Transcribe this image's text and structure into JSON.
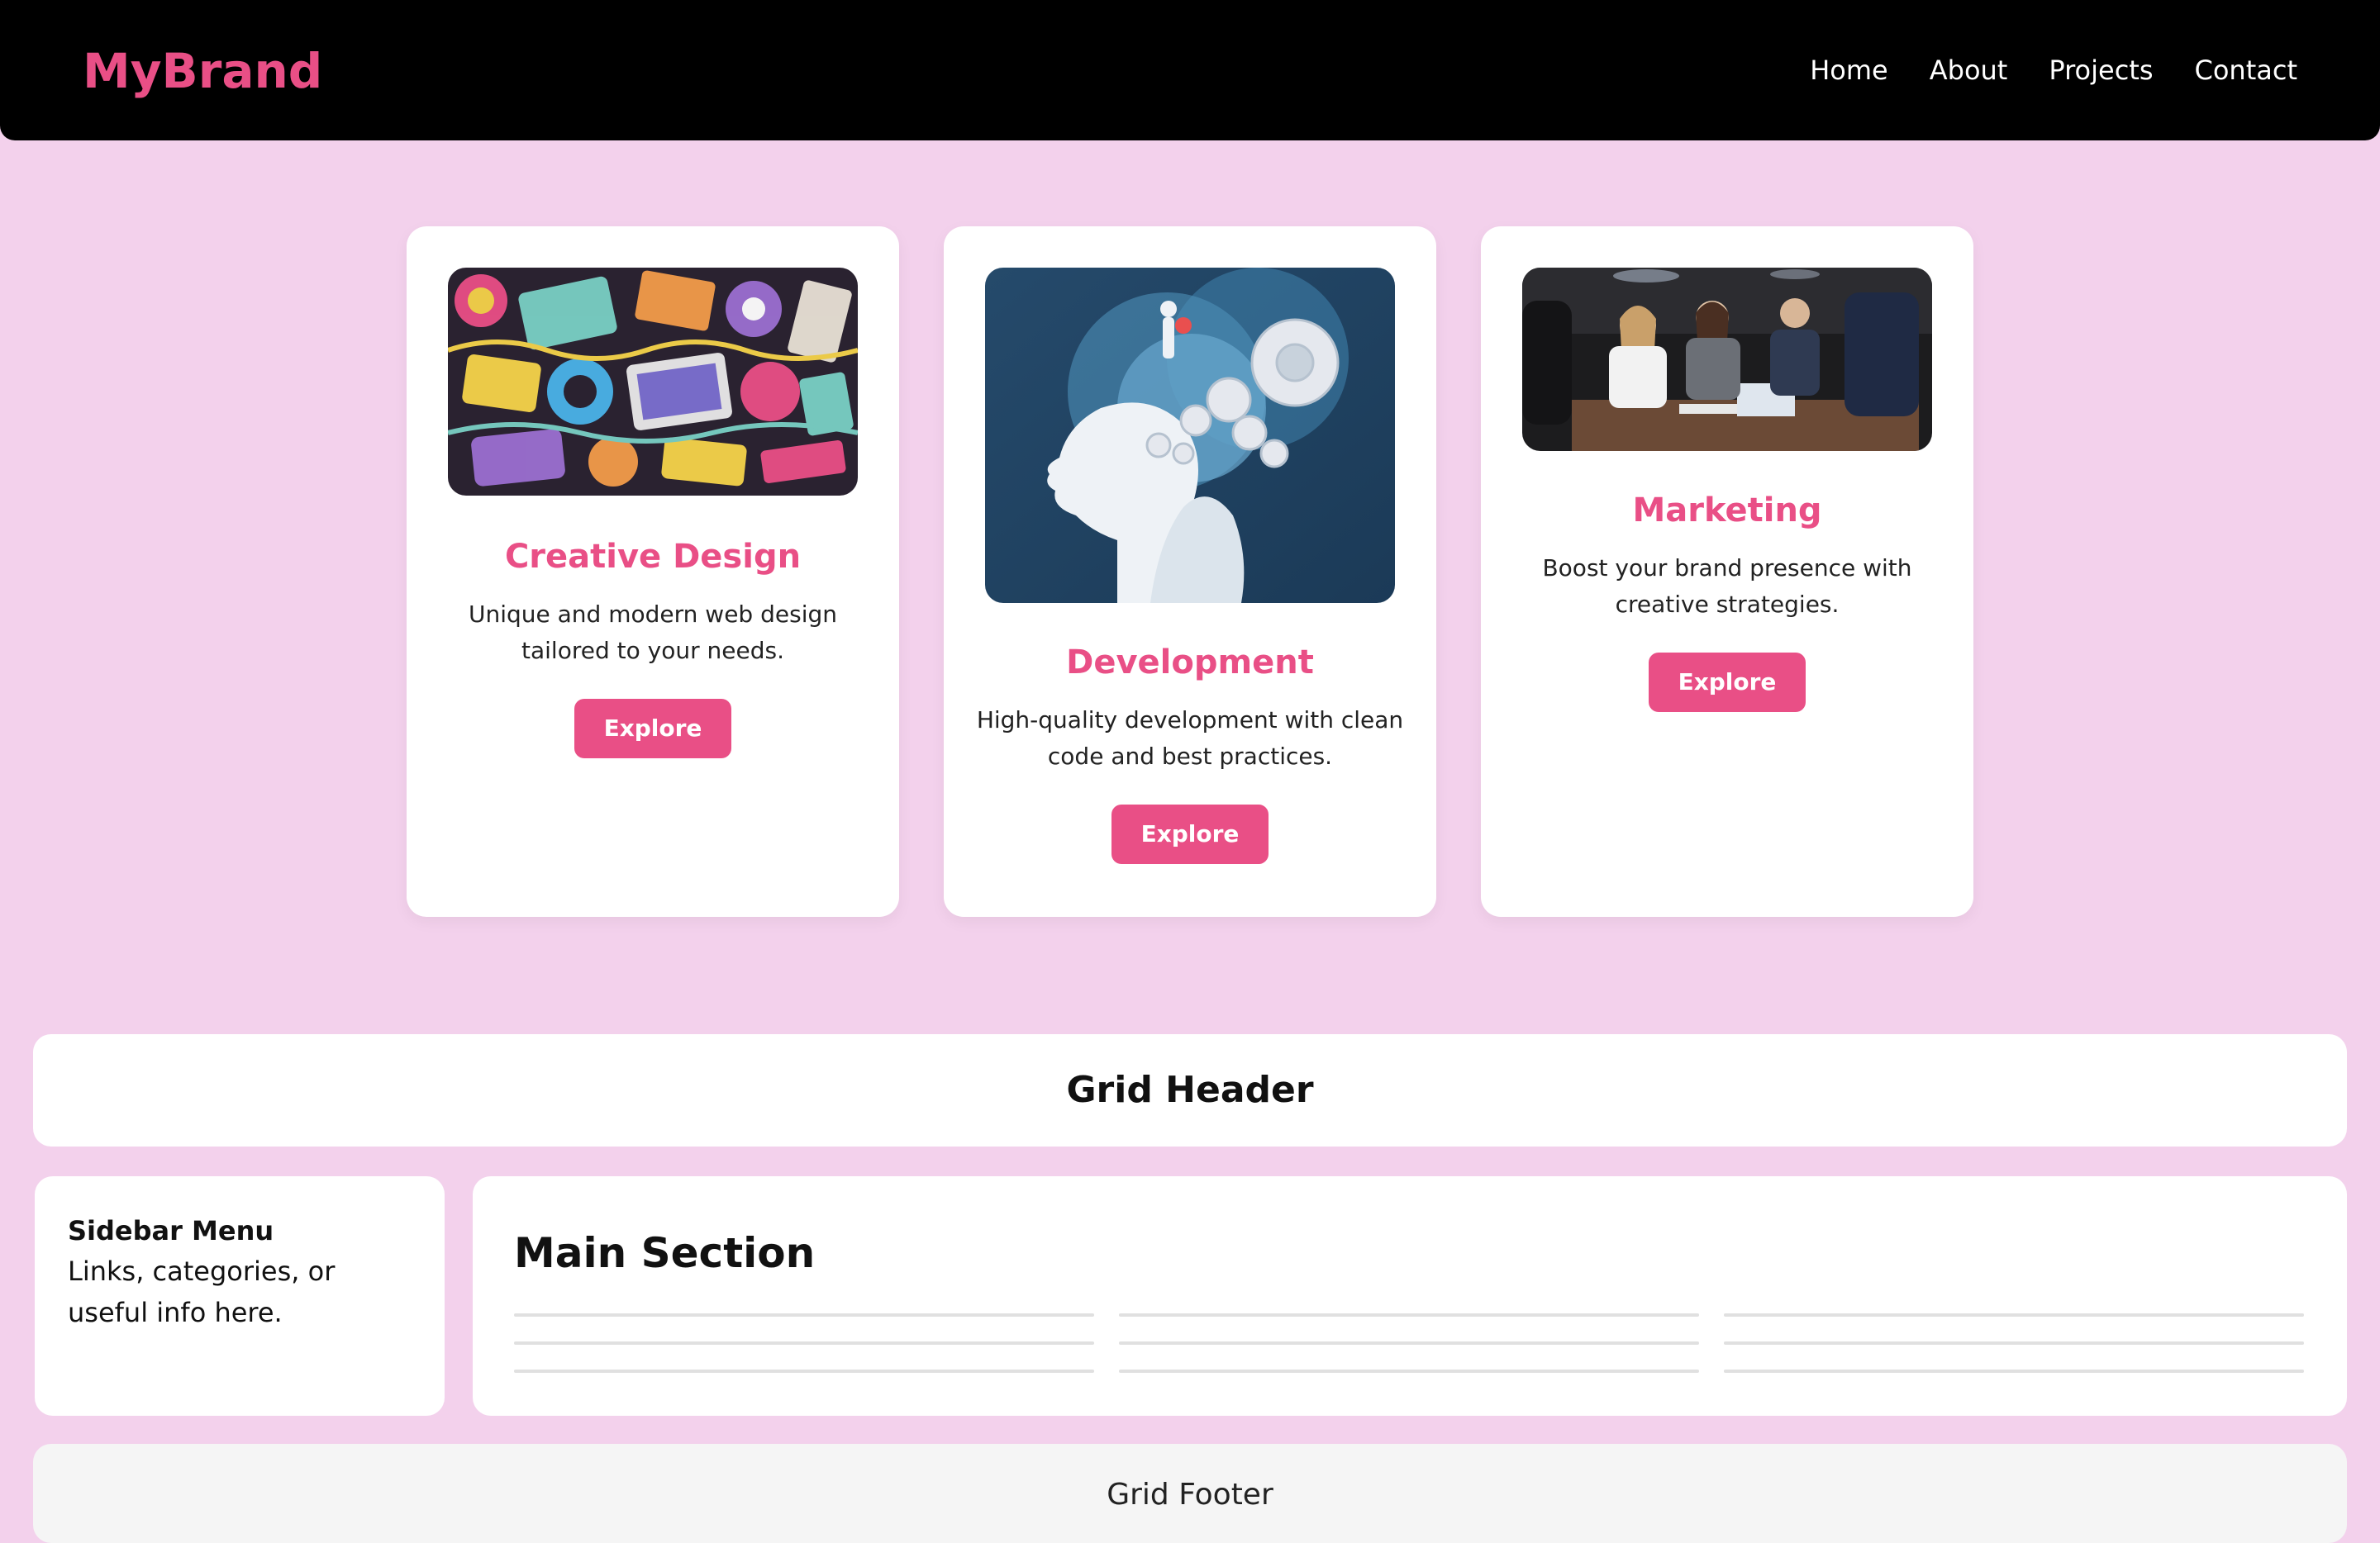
{
  "navbar": {
    "brand": "MyBrand",
    "links": [
      "Home",
      "About",
      "Projects",
      "Contact"
    ]
  },
  "cards": [
    {
      "title": "Creative Design",
      "description": "Unique and modern web design tailored to your needs.",
      "button": "Explore",
      "image": "doodle-illustration"
    },
    {
      "title": "Development",
      "description": "High-quality development with clean code and best practices.",
      "button": "Explore",
      "image": "head-gears-illustration"
    },
    {
      "title": "Marketing",
      "description": "Boost your brand presence with creative strategies.",
      "button": "Explore",
      "image": "team-meeting-photo"
    }
  ],
  "grid": {
    "header": "Grid Header",
    "sidebar_title": "Sidebar Menu",
    "sidebar_text": "Links, categories, or useful info here.",
    "main_title": "Main Section",
    "footer": "Grid Footer"
  },
  "colors": {
    "accent": "#e94f86",
    "page_bg": "#f3d1ec",
    "navbar_bg": "#000000"
  }
}
